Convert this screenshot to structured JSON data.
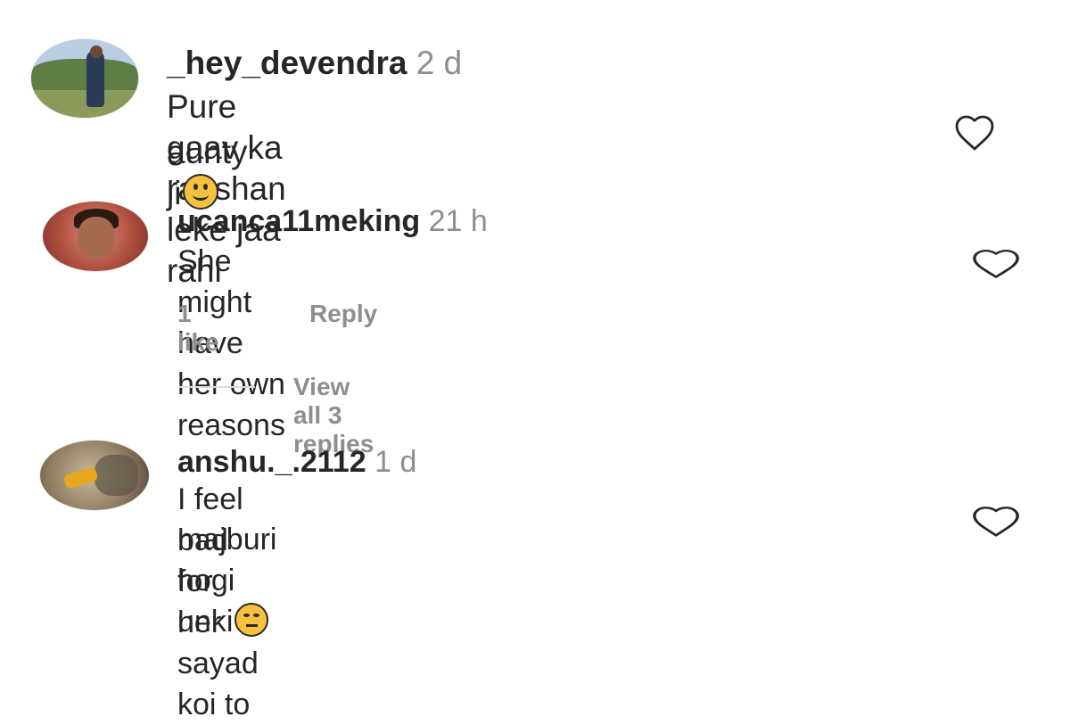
{
  "comments": [
    {
      "username": "_hey_devendra",
      "time": "2 d",
      "text_line1": "Pure gaav ka raashan leke jaa rahi",
      "text_line2": "aunty ji",
      "emoji": "smiling-face",
      "avatar": "profile photo of man standing outdoors"
    },
    {
      "username": "ucanca11meking",
      "time": "21 h",
      "text_line1": "She might have her own reasons",
      "likes": "1 like",
      "reply_label": "Reply",
      "view_replies": "View all 3 replies",
      "avatar": "profile photo close-up face"
    },
    {
      "username": "anshu._.2112",
      "time": "1 d",
      "text_line1": "I feel bad for her sayad koi to",
      "text_line2": "majburi hogi unki",
      "emoji": "disappointed-face",
      "avatar": "profile photo blurred"
    }
  ],
  "icons": {
    "like": "heart-outline-icon"
  },
  "colors": {
    "text": "#262626",
    "muted": "#8e8e8e",
    "divider": "#dbdbdb",
    "emoji": "#f6c23d"
  }
}
